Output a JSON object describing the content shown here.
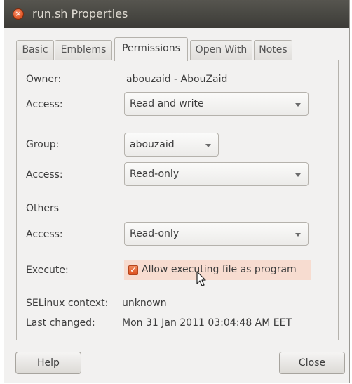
{
  "window": {
    "title": "run.sh Properties",
    "close_glyph": "×"
  },
  "tabs": [
    {
      "label": "Basic"
    },
    {
      "label": "Emblems"
    },
    {
      "label": "Permissions",
      "active": true
    },
    {
      "label": "Open With"
    },
    {
      "label": "Notes"
    }
  ],
  "permissions": {
    "owner_label": "Owner:",
    "owner_value": "abouzaid - AbouZaid",
    "owner_access_label": "Access:",
    "owner_access_value": "Read and write",
    "group_label": "Group:",
    "group_value": "abouzaid",
    "group_access_label": "Access:",
    "group_access_value": "Read-only",
    "others_label": "Others",
    "others_access_label": "Access:",
    "others_access_value": "Read-only",
    "execute_label": "Execute:",
    "execute_checkbox_label": "Allow executing file as program",
    "execute_checked": true,
    "check_glyph": "✓",
    "selinux_label": "SELinux context:",
    "selinux_value": "unknown",
    "last_changed_label": "Last changed:",
    "last_changed_value": "Mon 31 Jan 2011 03:04:48 AM EET"
  },
  "buttons": {
    "help": "Help",
    "close": "Close"
  },
  "colors": {
    "accent": "#dd4f1d",
    "titlebar": "#3c3b37",
    "highlight": "#f7dcd0"
  }
}
